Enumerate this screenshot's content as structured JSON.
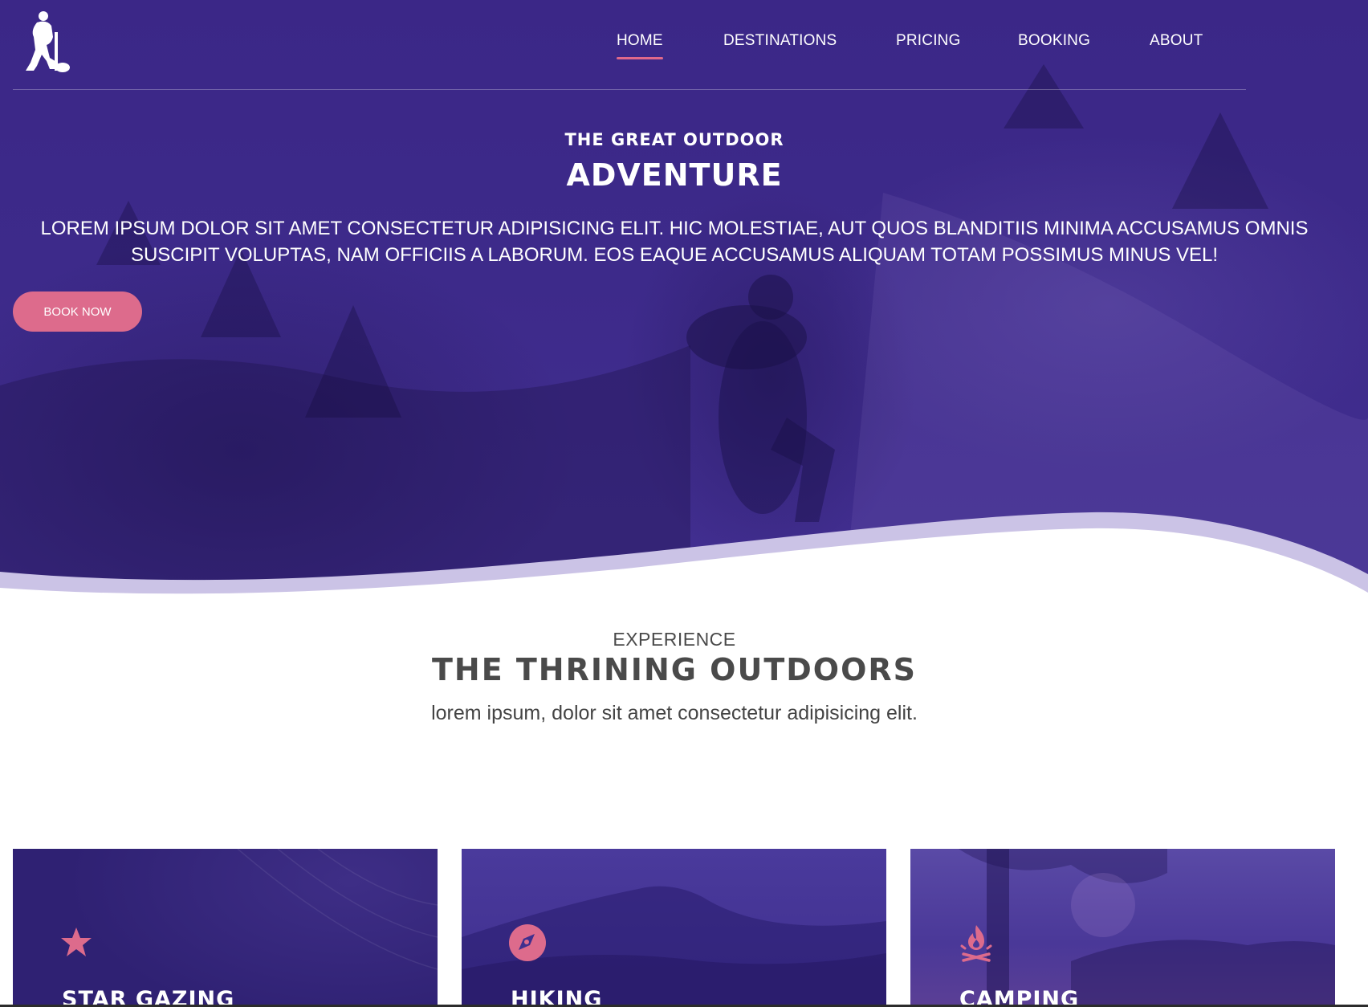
{
  "nav": {
    "items": [
      {
        "label": "HOME",
        "active": true
      },
      {
        "label": "DESTINATIONS",
        "active": false
      },
      {
        "label": "PRICING",
        "active": false
      },
      {
        "label": "BOOKING",
        "active": false
      },
      {
        "label": "ABOUT",
        "active": false
      }
    ]
  },
  "hero": {
    "eyebrow": "THE GREAT OUTDOOR",
    "title": "ADVENTURE",
    "text": "LOREM IPSUM DOLOR SIT AMET CONSECTETUR ADIPISICING ELIT. HIC MOLESTIAE, AUT QUOS BLANDITIIS MINIMA ACCUSAMUS OMNIS SUSCIPIT VOLUPTAS, NAM OFFICIIS A LABORUM. EOS EAQUE ACCUSAMUS ALIQUAM TOTAM POSSIMUS MINUS VEL!",
    "button_label": "BOOK NOW"
  },
  "intro": {
    "eyebrow": "EXPERIENCE",
    "title": "THE THRINING OUTDOORS",
    "subtitle": "lorem ipsum, dolor sit amet consectetur adipisicing elit."
  },
  "cards": [
    {
      "title": "STAR GAZING",
      "icon": "star-icon"
    },
    {
      "title": "HIKING",
      "icon": "compass-icon"
    },
    {
      "title": "CAMPING",
      "icon": "campfire-icon"
    }
  ],
  "colors": {
    "primary": "#3d2a8a",
    "accent": "#dd6b8c",
    "text_dark": "#4a4a4a"
  }
}
